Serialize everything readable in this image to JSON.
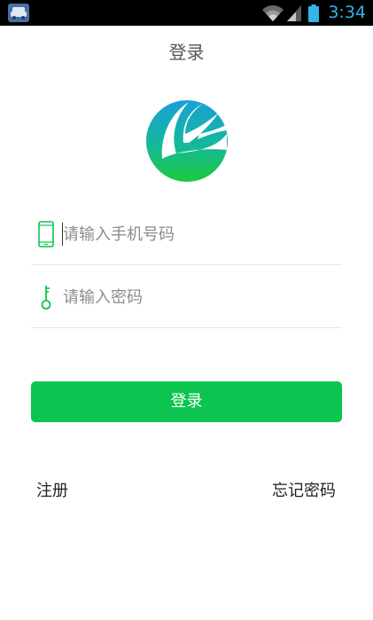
{
  "status_bar": {
    "time": "3:34",
    "app_icon": "car-icon",
    "wifi_icon": "wifi-icon",
    "signal_icon": "signal-icon",
    "battery_icon": "battery-icon",
    "time_color": "#33b5e5"
  },
  "header": {
    "title": "登录"
  },
  "logo": {
    "icon": "app-logo-icon"
  },
  "form": {
    "phone": {
      "icon": "phone-icon",
      "placeholder": "请输入手机号码",
      "value": ""
    },
    "password": {
      "icon": "key-icon",
      "placeholder": "请输入密码",
      "value": ""
    }
  },
  "actions": {
    "login_label": "登录",
    "register_label": "注册",
    "forgot_label": "忘记密码"
  },
  "colors": {
    "accent": "#0cc44f",
    "logo_blue": "#1aa0d8",
    "logo_green": "#1ec83c",
    "status_bar_bg": "#000000"
  }
}
